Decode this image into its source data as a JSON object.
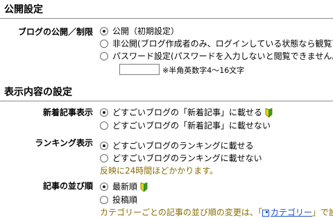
{
  "sections": {
    "public": {
      "title": "公開設定"
    },
    "display": {
      "title": "表示内容の設定"
    }
  },
  "blog_visibility": {
    "label": "ブログの公開／制限",
    "options": [
      {
        "text": "公開（初期設定）",
        "selected": true
      },
      {
        "text": "非公開(ブログ作成者のみ、ログインしている状態なら観覧可",
        "selected": false
      },
      {
        "text": "パスワード設定(パスワードを入力しないと閲覧できません。",
        "selected": false
      }
    ],
    "password": {
      "value": "",
      "hint": "※半角英数字4～16文字"
    }
  },
  "new_articles": {
    "label": "新着記事表示",
    "options": [
      {
        "text": "どすごいブログの「新着記事」に載せる",
        "selected": true,
        "badge": true
      },
      {
        "text": "どすごいブログの「新着記事」に載せない",
        "selected": false
      }
    ]
  },
  "ranking": {
    "label": "ランキング表示",
    "options": [
      {
        "text": "どすごいブログのランキングに載せる",
        "selected": true
      },
      {
        "text": "どすごいブログのランキングに載せない",
        "selected": false
      }
    ],
    "note": "反映に24時間ほどかかります。"
  },
  "article_order": {
    "label": "記事の並び順",
    "options": [
      {
        "text": "最新順",
        "selected": true,
        "badge": true
      },
      {
        "text": "投稿順",
        "selected": false
      }
    ],
    "note_before": "カテゴリーごとの記事の並び順の変更は、「",
    "note_link": "カテゴリー",
    "note_after": "」で設定"
  },
  "colors": {
    "note": "#8a6d00",
    "link": "#1a4fc4",
    "rule": "#8a8a8a"
  },
  "icons": {
    "badge": "beginner-mark-icon",
    "link": "external-link-icon"
  }
}
